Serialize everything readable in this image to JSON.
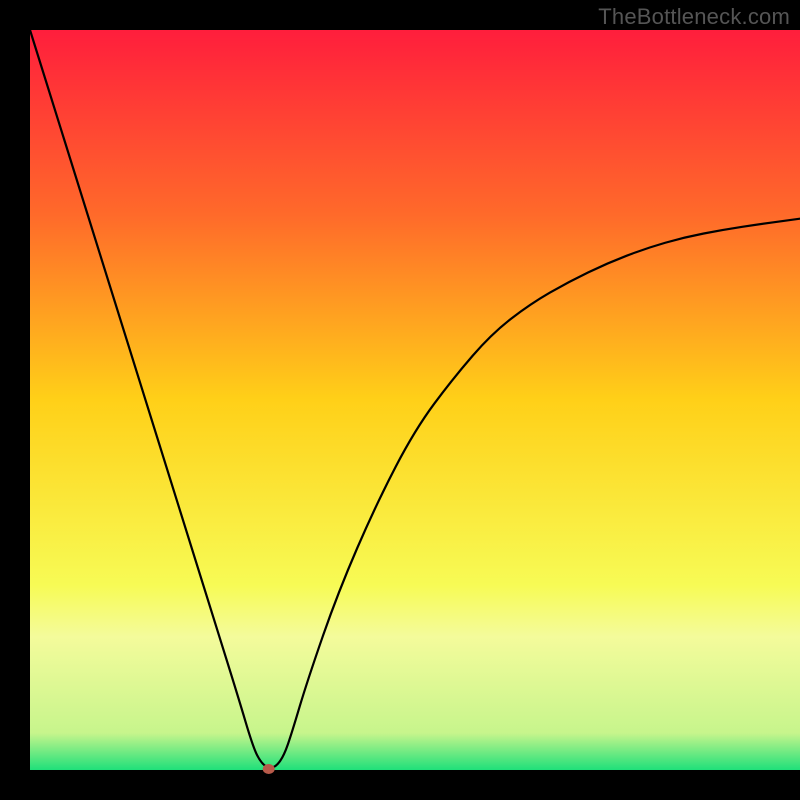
{
  "watermark": "TheBottleneck.com",
  "chart_data": {
    "type": "line",
    "title": "",
    "xlabel": "",
    "ylabel": "",
    "xlim": [
      0,
      100
    ],
    "ylim": [
      0,
      100
    ],
    "background_gradient_stops": [
      {
        "y": 100,
        "color": "#ff1e3c"
      },
      {
        "y": 75,
        "color": "#ff6a2a"
      },
      {
        "y": 50,
        "color": "#ffd018"
      },
      {
        "y": 25,
        "color": "#f7fb55"
      },
      {
        "y": 18,
        "color": "#f4fb9b"
      },
      {
        "y": 5,
        "color": "#c7f58c"
      },
      {
        "y": 0,
        "color": "#1fe07a"
      }
    ],
    "series": [
      {
        "name": "bottleneck-curve",
        "x": [
          0,
          3,
          6,
          9,
          12,
          15,
          18,
          21,
          24,
          27,
          29,
          30,
          31,
          32,
          33,
          34,
          36,
          40,
          45,
          50,
          55,
          60,
          65,
          70,
          75,
          80,
          85,
          90,
          95,
          100
        ],
        "y": [
          100,
          90,
          80,
          70,
          60,
          50,
          40,
          30,
          20,
          10,
          3,
          1,
          0.2,
          0.5,
          2,
          5,
          12,
          24,
          36,
          46,
          53,
          59,
          63,
          66,
          68.5,
          70.5,
          72,
          73,
          73.8,
          74.5
        ]
      }
    ],
    "optimal_marker": {
      "x": 31,
      "y": 0,
      "color": "#b85a4a",
      "rx": 6,
      "ry": 5
    }
  }
}
